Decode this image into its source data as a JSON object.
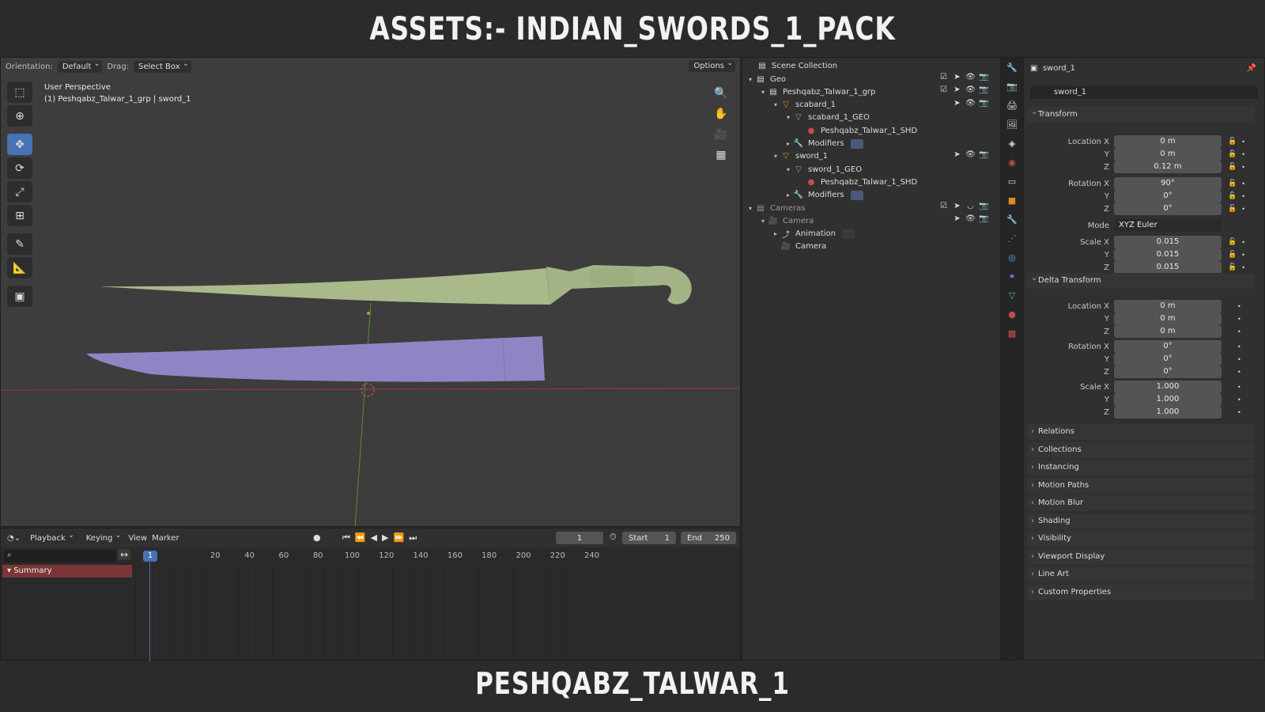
{
  "banner": {
    "top": "ASSETS:- INDIAN_SWORDS_1_PACK",
    "bottom": "PESHQABZ_TALWAR_1"
  },
  "viewport": {
    "orientation_label": "Orientation:",
    "orientation_value": "Default",
    "drag_label": "Drag:",
    "drag_value": "Select Box",
    "options": "Options",
    "info_line1": "User Perspective",
    "info_line2": "(1) Peshqabz_Talwar_1_grp | sword_1",
    "colors": {
      "sword": "#a9b98a",
      "scabbard": "#8e86c4",
      "x_axis": "#a03a3a",
      "y_axis": "#5e8a3a"
    }
  },
  "timeline": {
    "playback": "Playback",
    "keying": "Keying",
    "view": "View",
    "marker": "Marker",
    "current_frame": "1",
    "start_label": "Start",
    "start_value": "1",
    "end_label": "End",
    "end_value": "250",
    "ticks": [
      "1",
      "20",
      "40",
      "60",
      "80",
      "100",
      "120",
      "140",
      "160",
      "180",
      "200",
      "220",
      "240"
    ],
    "summary": "Summary"
  },
  "outliner": {
    "title": "Scene Collection",
    "rows": [
      {
        "label": "Geo"
      },
      {
        "label": "Peshqabz_Talwar_1_grp"
      },
      {
        "label": "scabard_1"
      },
      {
        "label": "scabard_1_GEO"
      },
      {
        "label": "Peshqabz_Talwar_1_SHD"
      },
      {
        "label": "Modifiers"
      },
      {
        "label": "sword_1"
      },
      {
        "label": "sword_1_GEO"
      },
      {
        "label": "Peshqabz_Talwar_1_SHD"
      },
      {
        "label": "Modifiers"
      },
      {
        "label": "Cameras"
      },
      {
        "label": "Camera"
      },
      {
        "label": "Animation"
      },
      {
        "label": "Camera"
      }
    ]
  },
  "properties": {
    "header": "sword_1",
    "object_name": "sword_1",
    "transform": {
      "title": "Transform",
      "location_label": "Location X",
      "location": [
        "0 m",
        "0 m",
        "0.12 m"
      ],
      "rotation_label": "Rotation X",
      "rotation": [
        "90°",
        "0°",
        "0°"
      ],
      "mode_label": "Mode",
      "mode": "XYZ Euler",
      "scale_label": "Scale X",
      "scale": [
        "0.015",
        "0.015",
        "0.015"
      ]
    },
    "delta": {
      "title": "Delta Transform",
      "location_label": "Location X",
      "location": [
        "0 m",
        "0 m",
        "0 m"
      ],
      "rotation_label": "Rotation X",
      "rotation": [
        "0°",
        "0°",
        "0°"
      ],
      "scale_label": "Scale X",
      "scale": [
        "1.000",
        "1.000",
        "1.000"
      ]
    },
    "y_label": "Y",
    "z_label": "Z",
    "sections": [
      "Relations",
      "Collections",
      "Instancing",
      "Motion Paths",
      "Motion Blur",
      "Shading",
      "Visibility",
      "Viewport Display",
      "Line Art",
      "Custom Properties"
    ]
  }
}
